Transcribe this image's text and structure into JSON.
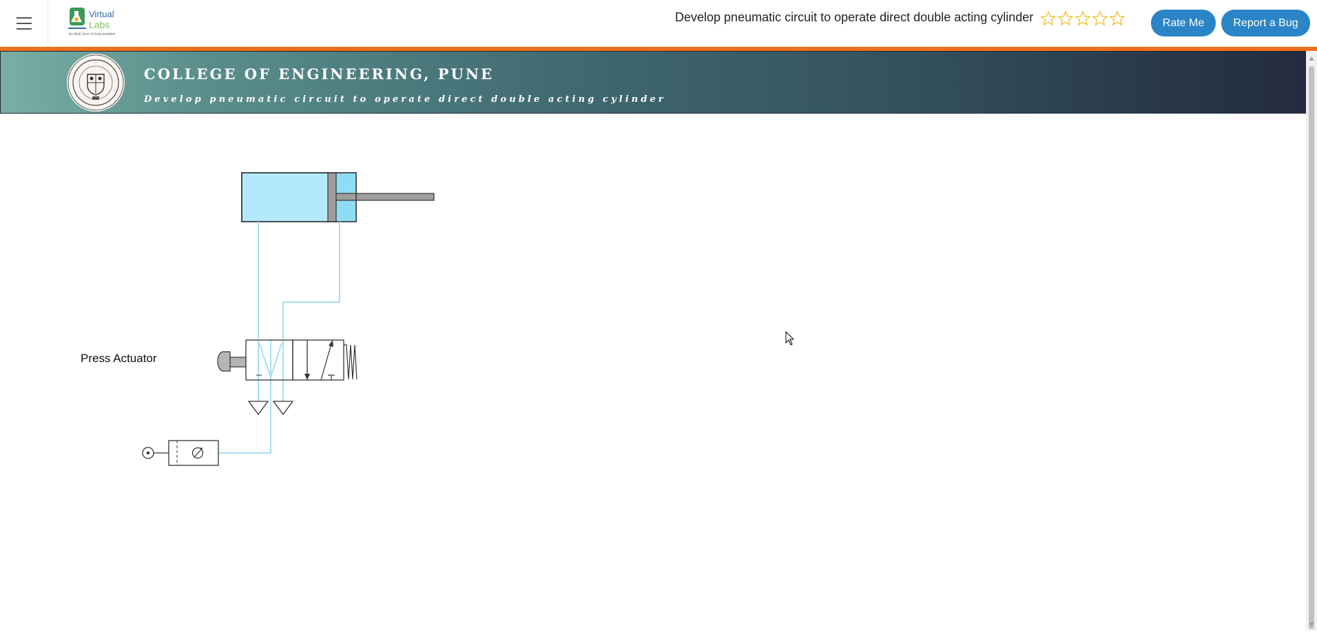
{
  "header": {
    "experiment_title": "Develop pneumatic circuit to operate direct double acting cylinder",
    "logo_text_top": "Virtual",
    "logo_text_bottom": "Labs",
    "logo_tagline": "An MoE Govt of India Initiative",
    "rate_button": "Rate Me",
    "bug_button": "Report a Bug",
    "rating_stars": 5,
    "accent_color": "#f06f1c",
    "button_color": "#2a84c6"
  },
  "banner": {
    "college_name": "COLLEGE OF ENGINEERING, PUNE",
    "subtitle": "Develop pneumatic circuit to operate direct double acting cylinder"
  },
  "simulation": {
    "actuator_label": "Press Actuator",
    "air_line_color": "#a9def0",
    "cylinder_fill": "#a9e6f7"
  }
}
